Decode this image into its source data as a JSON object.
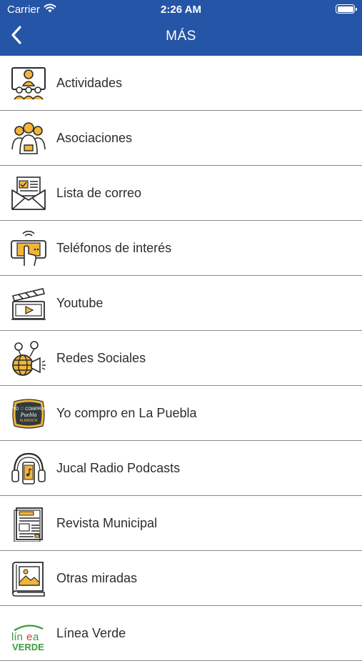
{
  "status_bar": {
    "carrier": "Carrier",
    "time": "2:26 AM"
  },
  "nav": {
    "title": "MÁS",
    "back_icon": "chevron-left-icon"
  },
  "colors": {
    "header_bg": "#2555a6",
    "icon_accent": "#f2b53a",
    "icon_line": "#2b2b2b",
    "linea_verde_green": "#3a9b3c",
    "linea_verde_red": "#d9342b"
  },
  "menu_items": [
    {
      "label": "Actividades",
      "icon": "presentation-audience-icon"
    },
    {
      "label": "Asociaciones",
      "icon": "group-people-icon"
    },
    {
      "label": "Lista de correo",
      "icon": "mail-envelope-icon"
    },
    {
      "label": "Teléfonos de interés",
      "icon": "phone-touch-icon"
    },
    {
      "label": "Youtube",
      "icon": "video-clapper-icon"
    },
    {
      "label": "Redes Sociales",
      "icon": "social-globe-megaphone-icon"
    },
    {
      "label": "Yo compro en La Puebla",
      "icon": "yo-compro-badge-icon",
      "logo_text": "YO COMPRO Puebla ALIMENTA"
    },
    {
      "label": "Jucal Radio Podcasts",
      "icon": "headphones-podcast-icon"
    },
    {
      "label": "Revista Municipal",
      "icon": "magazine-icon"
    },
    {
      "label": "Otras miradas",
      "icon": "picture-book-icon"
    },
    {
      "label": "Línea Verde",
      "icon": "linea-verde-logo-icon",
      "logo_text": "línea VERDE"
    }
  ]
}
